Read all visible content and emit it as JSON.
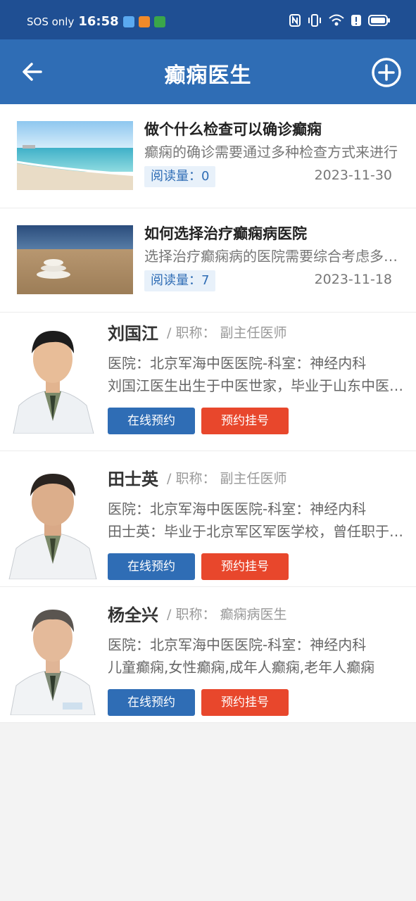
{
  "status_bar": {
    "network": "SOS only",
    "time": "16:58"
  },
  "header": {
    "title": "癫痫医生"
  },
  "articles": [
    {
      "title": "做个什么检查可以确诊癫痫",
      "summary": "癫痫的确诊需要通过多种检查方式来进行",
      "read_label": "阅读量：0",
      "date": "2023-11-30"
    },
    {
      "title": "如何选择治疗癫痫病医院",
      "summary": "选择治疗癫痫病的医院需要综合考虑多方面因素",
      "read_label": "阅读量：7",
      "date": "2023-11-18"
    }
  ],
  "doctors": [
    {
      "name": "刘国江",
      "title": "/ 职称：  副主任医师",
      "hospital": "医院：北京军海中医医院-科室：神经内科",
      "bio": "刘国江医生出生于中医世家，毕业于山东中医药大学",
      "online_label": "在线预约",
      "register_label": "预约挂号"
    },
    {
      "name": "田士英",
      "title": "/ 职称：  副主任医师",
      "hospital": "医院：北京军海中医医院-科室：神经内科",
      "bio": "田士英：毕业于北京军区军医学校，曾任职于多家医院",
      "online_label": "在线预约",
      "register_label": "预约挂号"
    },
    {
      "name": "杨全兴",
      "title": "/ 职称：  癫痫病医生",
      "hospital": "医院：北京军海中医医院-科室：神经内科",
      "bio": "儿童癫痫,女性癫痫,成年人癫痫,老年人癫痫",
      "online_label": "在线预约",
      "register_label": "预约挂号"
    }
  ],
  "colors": {
    "status_bar": "#1f4f93",
    "header": "#2f6db5",
    "primary_button": "#2f6db5",
    "secondary_button": "#e8472c"
  },
  "icons": {
    "back": "arrow-left-icon",
    "add": "plus-circle-icon"
  }
}
